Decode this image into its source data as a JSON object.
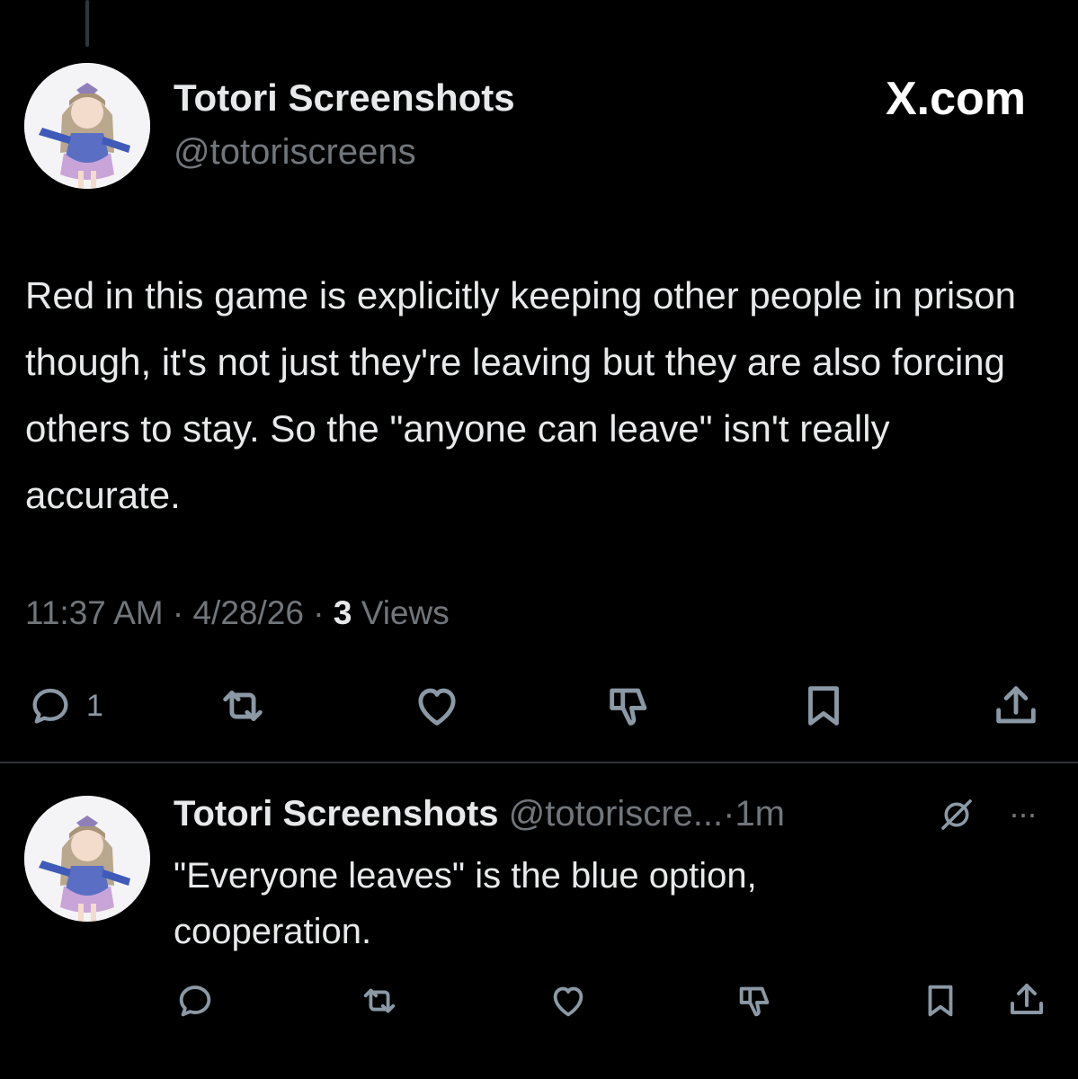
{
  "site_label": "X.com",
  "main_post": {
    "author_name": "Totori Screenshots",
    "handle": "@totoriscreens",
    "text": "Red in this game is explicitly keeping other people in prison though, it's not just they're leaving but they are also forcing others to stay. So the \"anyone can leave\" isn't really accurate.",
    "time": "11:37 AM",
    "date": "4/28/26",
    "views_count": "3",
    "views_label": "Views",
    "separator": "·",
    "reply_count": "1"
  },
  "reply_post": {
    "author_name": "Totori Screenshots",
    "handle": "@totoriscre...",
    "separator": "·",
    "time_ago": "1m",
    "more": "···",
    "text": "\"Everyone leaves\" is the blue option, cooperation."
  },
  "icons": [
    "reply-icon",
    "repost-icon",
    "like-icon",
    "downvote-icon",
    "bookmark-icon",
    "share-icon",
    "grok-icon",
    "more-icon"
  ],
  "colors": {
    "background": "#000000",
    "text": "#e7e9ea",
    "muted": "#71767b",
    "divider": "#2f3336"
  }
}
